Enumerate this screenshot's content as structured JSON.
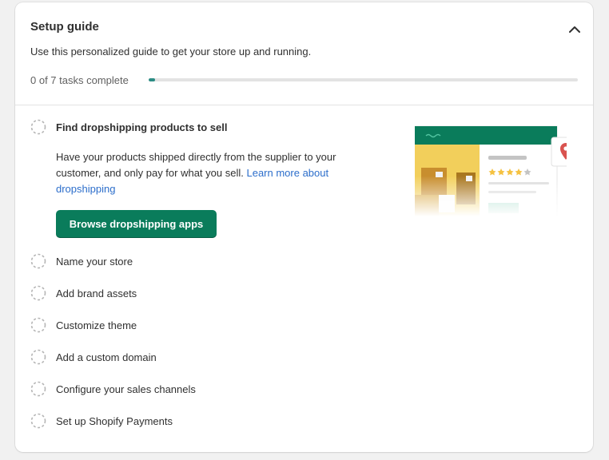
{
  "card": {
    "title": "Setup guide",
    "subtitle": "Use this personalized guide to get your store up and running.",
    "progress_text": "0 of 7 tasks complete",
    "progress": 0.015,
    "collapse_icon": "chevron-up-icon"
  },
  "active_task": {
    "label": "Find dropshipping products to sell",
    "description": "Have your products shipped directly from the supplier to your customer, and only pay for what you sell.",
    "link_text": "Learn more about dropshipping",
    "button_label": "Browse dropshipping apps"
  },
  "tasks": [
    {
      "label": "Name your store"
    },
    {
      "label": "Add brand assets"
    },
    {
      "label": "Customize theme"
    },
    {
      "label": "Add a custom domain"
    },
    {
      "label": "Configure your sales channels"
    },
    {
      "label": "Set up Shopify Payments"
    }
  ],
  "colors": {
    "brand_green": "#0a7c5b",
    "progress": "#2b8c84",
    "link": "#2c6ecb",
    "map_pin": "#d9534f",
    "illustration_yellow": "#f2cf5b"
  }
}
